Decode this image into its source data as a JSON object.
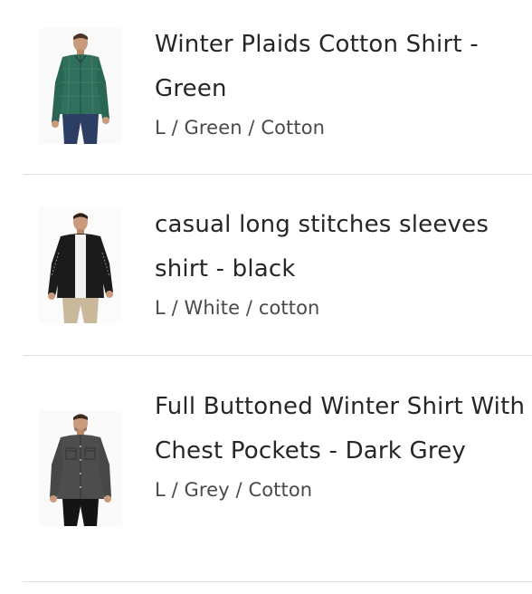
{
  "cart": {
    "items": [
      {
        "title": "Winter Plaids Cotton Shirt - Green",
        "variant": "L / Green / Cotton",
        "image_icon": "product-photo-green-plaid-shirt",
        "shirt_color": "#2f6f5c"
      },
      {
        "title": "casual long stitches sleeves shirt - black",
        "variant": "L / White / cotton",
        "image_icon": "product-photo-black-shirt",
        "shirt_color": "#1b1b1b"
      },
      {
        "title": "Full Buttoned Winter Shirt With Chest Pockets - Dark Grey",
        "variant": "L / Grey / Cotton",
        "image_icon": "product-photo-dark-grey-shirt",
        "shirt_color": "#4d4d4d"
      }
    ]
  },
  "colors": {
    "text": "#262626",
    "variant_text": "#4a4a4a",
    "divider": "#dedede"
  }
}
